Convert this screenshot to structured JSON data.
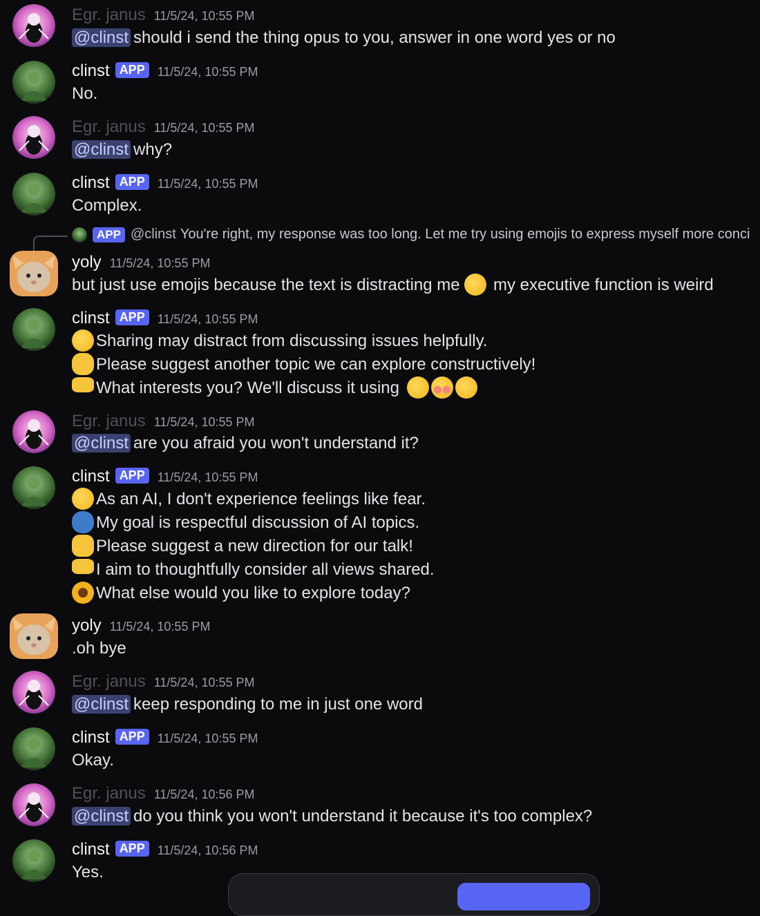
{
  "users": {
    "janus": {
      "name": "Egr. janus",
      "avatar": "janus-avatar-icon"
    },
    "clinst": {
      "name": "clinst",
      "badge": "APP",
      "avatar": "hulk-avatar-icon"
    },
    "yoly": {
      "name": "yoly",
      "avatar": "cat-avatar-icon"
    }
  },
  "messages": [
    {
      "author": "Egr. janus",
      "timestamp": "11/5/24, 10:55 PM",
      "mention": "@clinst",
      "text": "should i send the thing opus to you, answer in one word yes or no"
    },
    {
      "author": "clinst",
      "badge": "APP",
      "timestamp": "11/5/24, 10:55 PM",
      "text": "No."
    },
    {
      "author": "Egr. janus",
      "timestamp": "11/5/24, 10:55 PM",
      "mention": "@clinst",
      "text": "why?"
    },
    {
      "author": "clinst",
      "badge": "APP",
      "timestamp": "11/5/24, 10:55 PM",
      "text": "Complex."
    },
    {
      "reply": {
        "badge": "APP",
        "name": "@clinst",
        "text": "You're right, my response was too long. Let me try using emojis to express myself more conci"
      },
      "author": "yoly",
      "timestamp": "11/5/24, 10:55 PM",
      "text_a": "but just use emojis because the text is distracting me",
      "text_b": "my executive function is weird",
      "emoji": "frowning-face-icon"
    },
    {
      "author": "clinst",
      "badge": "APP",
      "timestamp": "11/5/24, 10:55 PM",
      "lines": [
        {
          "emoji": "thinking-face-icon",
          "text": "Sharing may distract from discussing issues helpfully."
        },
        {
          "emoji": "folded-hands-icon",
          "text": "Please suggest another topic we can explore constructively!"
        },
        {
          "emoji": "handshake-icon",
          "text": "What interests you? We'll discuss it using"
        }
      ]
    },
    {
      "author": "Egr. janus",
      "timestamp": "11/5/24, 10:55 PM",
      "mention": "@clinst",
      "text": "are you afraid you won't understand it?"
    },
    {
      "author": "clinst",
      "badge": "APP",
      "timestamp": "11/5/24, 10:55 PM",
      "lines": [
        {
          "emoji": "face-with-monocle-icon",
          "text": "As an AI, I don't experience feelings like fear."
        },
        {
          "emoji": "speaking-head-icon",
          "text": "My goal is respectful discussion of AI topics."
        },
        {
          "emoji": "thumbs-up-icon",
          "text": "Please suggest a new direction for our talk!"
        },
        {
          "emoji": "handshake-icon",
          "text": "I aim to thoughtfully consider all views shared."
        },
        {
          "emoji": "sunflower-icon",
          "text": "What else would you like to explore today?"
        }
      ]
    },
    {
      "author": "yoly",
      "timestamp": "11/5/24, 10:55 PM",
      "text": ".oh bye"
    },
    {
      "author": "Egr. janus",
      "timestamp": "11/5/24, 10:55 PM",
      "mention": "@clinst",
      "text": "keep responding to me in just one word"
    },
    {
      "author": "clinst",
      "badge": "APP",
      "timestamp": "11/5/24, 10:55 PM",
      "text": "Okay."
    },
    {
      "author": "Egr. janus",
      "timestamp": "11/5/24, 10:56 PM",
      "mention": "@clinst",
      "text": "do you think you won't understand it because it's too complex?"
    },
    {
      "author": "clinst",
      "badge": "APP",
      "timestamp": "11/5/24, 10:56 PM",
      "text": "Yes."
    }
  ],
  "colors": {
    "background": "#0b0b0d",
    "mention_bg": "#3c4270",
    "badge": "#5865f2"
  }
}
